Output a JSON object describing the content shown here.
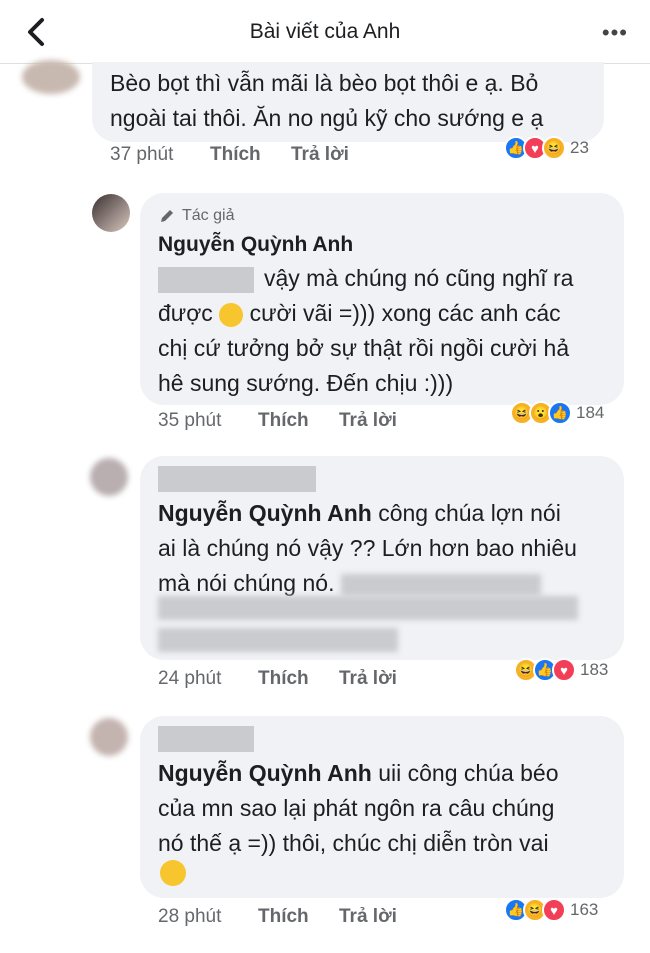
{
  "header": {
    "title": "Bài viết của Anh"
  },
  "comments": [
    {
      "text": "Bèo bọt thì vẫn mãi là bèo bọt thôi e ạ. Bỏ ngoài tai thôi. Ăn no ngủ kỹ cho sướng e ạ",
      "line1": "Bèo bọt thì vẫn mãi là bèo bọt thôi e ạ. Bỏ",
      "line2": "ngoài tai thôi. Ăn no ngủ kỹ cho sướng e ạ",
      "time": "37 phút",
      "like": "Thích",
      "reply": "Trả lời",
      "reaction_count": "23",
      "reactions": [
        "like-icon",
        "love-icon",
        "haha-icon"
      ]
    },
    {
      "badge": "Tác giả",
      "author": "Nguyễn Quỳnh Anh",
      "line1": "vậy mà chúng nó cũng nghĩ ra",
      "line2a": "được",
      "line2b": "cười vãi =))) xong các anh các",
      "line3": "chị cứ tưởng bở sự thật rồi ngồi cười hả",
      "line4": "hê sung sướng. Đến chịu :)))",
      "time": "35 phút",
      "like": "Thích",
      "reply": "Trả lời",
      "reaction_count": "184",
      "reactions": [
        "haha-icon",
        "wow-icon",
        "like-icon"
      ]
    },
    {
      "mention": "Nguyễn Quỳnh Anh",
      "line1": "công chúa lợn nói",
      "line2": "ai là chúng nó vậy ?? Lớn hơn bao nhiêu",
      "line3": "mà nói chúng nó.",
      "time": "24 phút",
      "like": "Thích",
      "reply": "Trả lời",
      "reaction_count": "183",
      "reactions": [
        "haha-icon",
        "like-icon",
        "love-icon"
      ]
    },
    {
      "mention": "Nguyễn Quỳnh Anh",
      "line1": "uii công chúa béo",
      "line2": "của mn sao lại phát ngôn ra câu chúng",
      "line3": "nó thế ạ =)) thôi, chúc chị diễn tròn vai",
      "time": "28 phút",
      "like": "Thích",
      "reply": "Trả lời",
      "reaction_count": "163",
      "reactions": [
        "like-icon",
        "haha-icon",
        "love-icon"
      ]
    }
  ],
  "colors": {
    "like": "#1877f2",
    "love": "#f33e58",
    "haha": "#f7b125",
    "bubble": "#f0f2f5",
    "meta": "#65676b"
  }
}
